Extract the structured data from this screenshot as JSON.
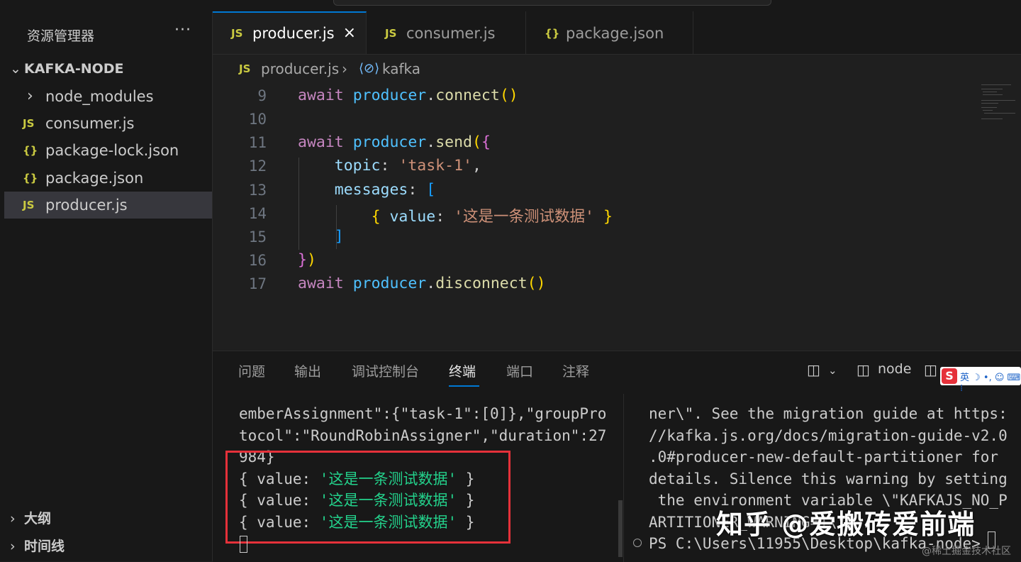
{
  "explorer": {
    "title": "资源管理器",
    "more": "···",
    "project": "KAFKA-NODE",
    "items": [
      {
        "icon": "›",
        "label": "node_modules",
        "kind": "folder"
      },
      {
        "icon": "JS",
        "label": "consumer.js",
        "kind": "js"
      },
      {
        "icon": "{}",
        "label": "package-lock.json",
        "kind": "json"
      },
      {
        "icon": "{}",
        "label": "package.json",
        "kind": "json"
      },
      {
        "icon": "JS",
        "label": "producer.js",
        "kind": "js",
        "active": true
      }
    ],
    "outline": "大纲",
    "timeline": "时间线"
  },
  "tabs": [
    {
      "icon": "JS",
      "label": "producer.js",
      "close": "×",
      "active": true
    },
    {
      "icon": "JS",
      "label": "consumer.js"
    },
    {
      "icon": "{}",
      "label": "package.json"
    }
  ],
  "breadcrumb": {
    "icon": "JS",
    "file": "producer.js",
    "sep": "›",
    "symbol_icon": "⟨⊘⟩",
    "symbol": "kafka"
  },
  "editor": {
    "line_numbers": [
      "9",
      "10",
      "11",
      "12",
      "13",
      "14",
      "15",
      "16",
      "17"
    ]
  },
  "panel": {
    "tabs": [
      "问题",
      "输出",
      "调试控制台",
      "终端",
      "端口",
      "注释"
    ],
    "active_tab": "终端",
    "shell": "node",
    "terminal_left": {
      "lines": [
        "emberAssignment\":{\"task-1\":[0]},\"groupPro",
        "tocol\":\"RoundRobinAssigner\",\"duration\":27",
        "984}"
      ],
      "value_prefix": "{ value: ",
      "value_string": "'这是一条测试数据'",
      "value_suffix": " }"
    },
    "terminal_right": {
      "lines": [
        "ner\\\". See the migration guide at https:",
        "//kafka.js.org/docs/migration-guide-v2.0",
        ".0#producer-new-default-partitioner for",
        "details. Silence this warning by setting",
        " the environment variable \\\"KAFKAJS_NO_P",
        "ARTITIONER_WARNING=1\\\"",
        "PS C:\\Users\\11955\\Desktop\\kafka-node>"
      ]
    }
  },
  "ime": {
    "logo": "S",
    "text": "英 ☽ •, ☺ ⌨ ⁞"
  },
  "watermark": {
    "main": "知乎 @爱搬砖爱前端",
    "small": "@稀土掘金技术社区"
  },
  "colors": {
    "accent": "#0078d4",
    "highlight_box": "#e5313a",
    "terminal_string": "#23d18b"
  }
}
